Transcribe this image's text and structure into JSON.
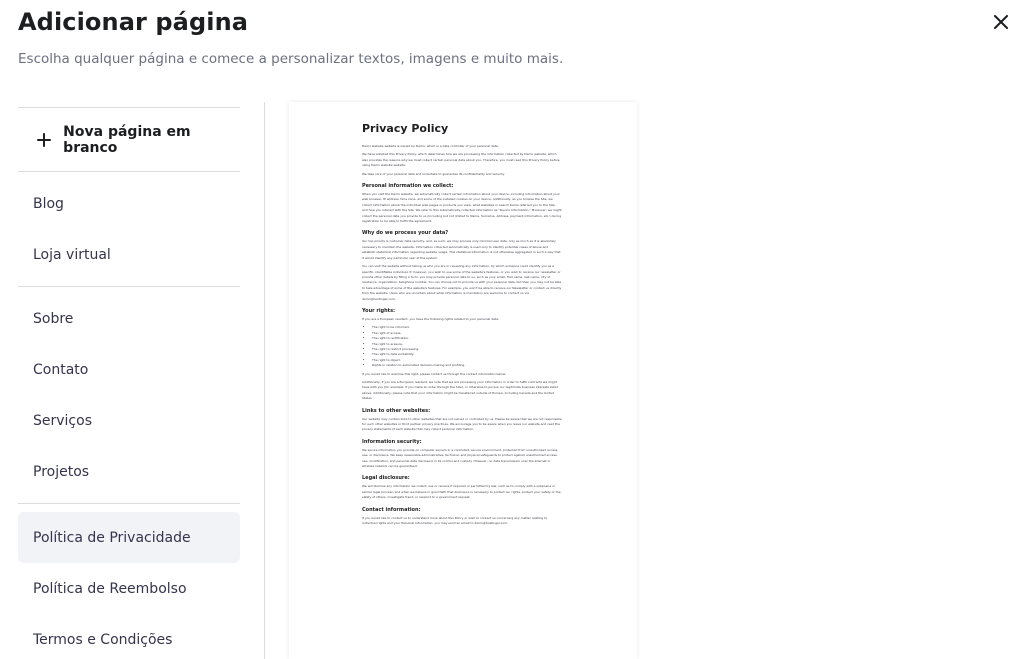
{
  "header": {
    "title": "Adicionar página",
    "subtitle": "Escolha qualquer página e comece a personalizar textos, imagens e muito mais."
  },
  "sidebar": {
    "new_page_label": "Nova página em branco",
    "group1": [
      "Blog",
      "Loja virtual"
    ],
    "group2": [
      "Sobre",
      "Contato",
      "Serviços",
      "Projetos"
    ],
    "group3": [
      "Política de Privacidade",
      "Política de Reembolso",
      "Termos e Condições"
    ],
    "active_item": "Política de Privacidade"
  },
  "preview": {
    "title": "Privacy Policy",
    "intro": [
      "Demo website website is owned by Demo, which is a data controller of your personal data.",
      "We have adopted this Privacy Policy, which determines how we are processing the information collected by Demo website, which also provides the reasons why we must collect certain personal data about you. Therefore, you must read this Privacy Policy before using Demo website website.",
      "We take care of your personal data and undertake to guarantee its confidentiality and security."
    ],
    "sections": [
      {
        "heading": "Personal information we collect:",
        "paragraphs": [
          "When you visit the Demo website, we automatically collect certain information about your device, including information about your web browser, IP address, time zone, and some of the installed cookies on your device. Additionally, as you browse the Site, we collect information about the individual web pages or products you view, what websites or search terms referred you to the Site, and how you interact with the Site. We refer to this automatically-collected information as \"Device Information.\" Moreover, we might collect the personal data you provide to us (including but not limited to Name, Surname, Address, payment information, etc.) during registration to be able to fulfill the agreement."
        ]
      },
      {
        "heading": "Why do we process your data?",
        "paragraphs": [
          "Our top priority is customer data security, and, as such, we may process only minimal user data, only as much as it is absolutely necessary to maintain the website. Information collected automatically is used only to identify potential cases of abuse and establish statistical information regarding website usage. This statistical information is not otherwise aggregated in such a way that it would identify any particular user of the system.",
          "You can visit the website without telling us who you are or revealing any information, by which someone could identify you as a specific, identifiable individual. If, however, you wish to use some of the website's features, or you wish to receive our newsletter or provide other details by filling a form, you may provide personal data to us, such as your email, first name, last name, city of residence, organization, telephone number. You can choose not to provide us with your personal data, but then you may not be able to take advantage of some of the website's features. For example, you won't be able to receive our Newsletter or contact us directly from the website. Users who are uncertain about what information is mandatory are welcome to contact us via demo@hostinger.com."
        ]
      },
      {
        "heading": "Your rights:",
        "paragraphs": [
          "If you are a European resident, you have the following rights related to your personal data:"
        ],
        "list": [
          "The right to be informed.",
          "The right of access.",
          "The right to rectification.",
          "The right to erasure.",
          "The right to restrict processing.",
          "The right to data portability.",
          "The right to object.",
          "Rights in relation to automated decision-making and profiling."
        ],
        "after": [
          "If you would like to exercise this right, please contact us through the contact information below.",
          "Additionally, if you are a European resident, we note that we are processing your information in order to fulfill contracts we might have with you (for example, if you make an order through the Site), or otherwise to pursue our legitimate business interests listed above. Additionally, please note that your information might be transferred outside of Europe, including Canada and the United States."
        ]
      },
      {
        "heading": "Links to other websites:",
        "paragraphs": [
          "Our website may contain links to other websites that are not owned or controlled by us. Please be aware that we are not responsible for such other websites or third parties' privacy practices. We encourage you to be aware when you leave our website and read the privacy statements of each website that may collect personal information."
        ]
      },
      {
        "heading": "Information security:",
        "paragraphs": [
          "We secure information you provide on computer servers in a controlled, secure environment, protected from unauthorized access, use, or disclosure. We keep reasonable administrative, technical, and physical safeguards to protect against unauthorized access, use, modification, and personal data disclosure in its control and custody. However, no data transmission over the Internet or wireless network can be guaranteed."
        ]
      },
      {
        "heading": "Legal disclosure:",
        "paragraphs": [
          "We will disclose any information we collect, use or receive if required or permitted by law, such as to comply with a subpoena or similar legal process, and when we believe in good faith that disclosure is necessary to protect our rights, protect your safety or the safety of others, investigate fraud, or respond to a government request."
        ]
      },
      {
        "heading": "Contact information:",
        "paragraphs": [
          "If you would like to contact us to understand more about this Policy or wish to contact us concerning any matter relating to individual rights and your Personal Information, you may send an email to demo@hostinger.com."
        ]
      }
    ]
  }
}
